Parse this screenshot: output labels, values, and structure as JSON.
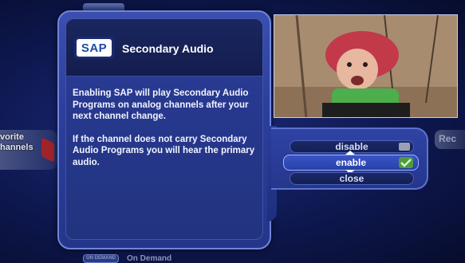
{
  "background": {
    "left_item_label": "vorite\nhannels",
    "right_item_label": "Rec",
    "bottom_logo": "ON DEMAND",
    "bottom_label": "On Demand"
  },
  "panel": {
    "badge": "SAP",
    "title": "Secondary Audio",
    "paragraphs": [
      "Enabling SAP will play Secondary Audio Programs on analog channels after your next channel change.",
      "If the channel does not carry Secondary Audio Programs you will hear the primary audio."
    ]
  },
  "options": {
    "disable": "disable",
    "enable": "enable",
    "close": "close",
    "selected": "enable"
  },
  "colors": {
    "accent": "#2c3f9c",
    "selected": "#2641a6",
    "check": "#4f9a3a"
  }
}
